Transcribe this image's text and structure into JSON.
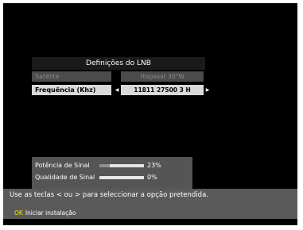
{
  "dialog": {
    "title": "Definições do LNB",
    "rows": [
      {
        "label": "Satélite",
        "value": "Hispasat 30°W"
      },
      {
        "label": "Frequência (Khz)",
        "value": "11811 27500 3 H"
      }
    ]
  },
  "signal": {
    "power_label": "Potência de Sinal",
    "power_value": "23%",
    "power_fraction": 0.23,
    "quality_label": "Qualidade de Sinal",
    "quality_value": "0%",
    "quality_fraction": 0
  },
  "help": {
    "text": "Use as teclas < ou > para seleccionar a opção pretendida.",
    "ok_key": "OK",
    "ok_action": "Iniciar instalação"
  },
  "colors": {
    "ok_key": "#f2e600",
    "selected_row": "#d9d9d9",
    "inactive_row": "#4b4b4b"
  }
}
